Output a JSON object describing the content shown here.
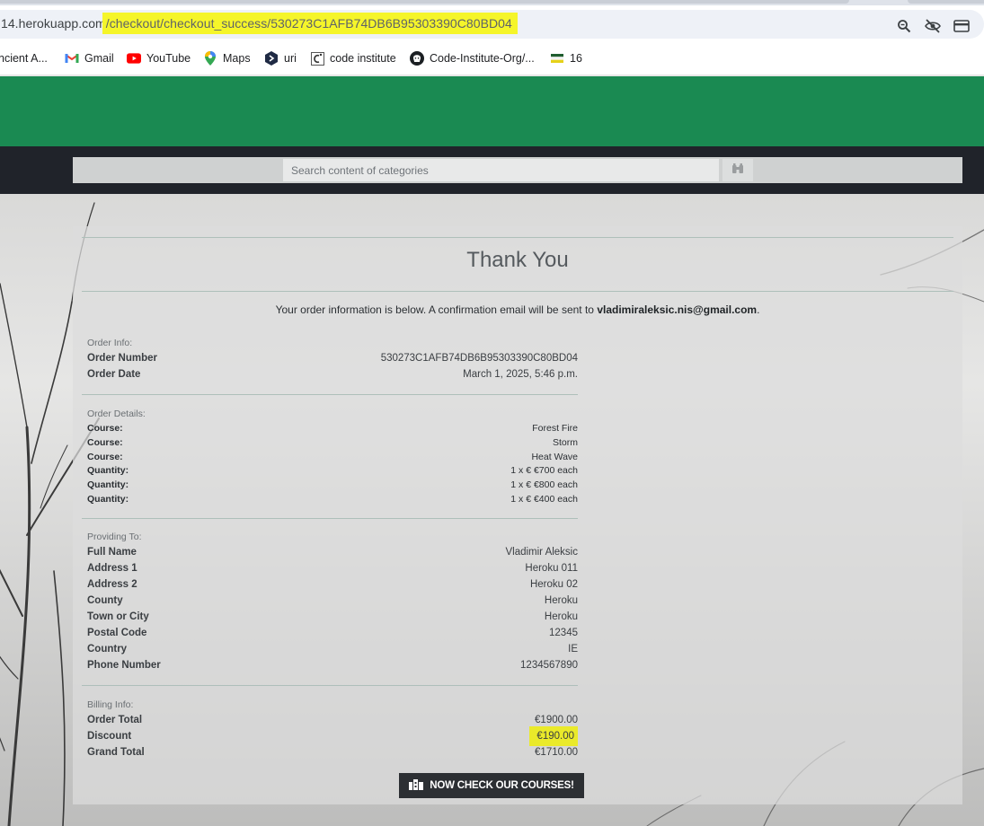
{
  "browser": {
    "url_prefix": "14.herokuapp.com",
    "url_path": "/checkout/checkout_success/530273C1AFB74DB6B95303390C80BD04",
    "address_icons": [
      "zoom-icon",
      "eye-slash-icon",
      "card-icon"
    ],
    "bookmarks": [
      {
        "label": "ncient A...",
        "icon": "page-icon"
      },
      {
        "label": "Gmail",
        "icon": "gmail-icon"
      },
      {
        "label": "YouTube",
        "icon": "youtube-icon"
      },
      {
        "label": "Maps",
        "icon": "maps-icon"
      },
      {
        "label": "uri",
        "icon": "uri-icon"
      },
      {
        "label": "code institute",
        "icon": "code-institute-icon"
      },
      {
        "label": "Code-Institute-Org/...",
        "icon": "github-icon"
      },
      {
        "label": "16",
        "icon": "flag-icon"
      }
    ]
  },
  "site": {
    "search_placeholder": "Search content of categories",
    "colors": {
      "header_green": "#1a8a52",
      "nav_dark": "#20232a"
    }
  },
  "page": {
    "title": "Thank You",
    "intro_text": "Your order information is below. A confirmation email will be sent to",
    "email": "vladimiraleksic.nis@gmail.com",
    "intro_end": ".",
    "order_info": {
      "label": "Order Info:",
      "rows": [
        {
          "label": "Order Number",
          "value": "530273C1AFB74DB6B95303390C80BD04"
        },
        {
          "label": "Order Date",
          "value": "March 1, 2025, 5:46 p.m."
        }
      ]
    },
    "order_details": {
      "label": "Order Details:",
      "rows": [
        {
          "label": "Course:",
          "value": "Forest Fire"
        },
        {
          "label": "Course:",
          "value": "Storm"
        },
        {
          "label": "Course:",
          "value": "Heat Wave"
        },
        {
          "label": "Quantity:",
          "value": "1 x € €700 each"
        },
        {
          "label": "Quantity:",
          "value": "1 x € €800 each"
        },
        {
          "label": "Quantity:",
          "value": "1 x € €400 each"
        }
      ]
    },
    "providing_to": {
      "label": "Providing To:",
      "rows": [
        {
          "label": "Full Name",
          "value": "Vladimir Aleksic"
        },
        {
          "label": "Address 1",
          "value": "Heroku 011"
        },
        {
          "label": "Address 2",
          "value": "Heroku 02"
        },
        {
          "label": "County",
          "value": "Heroku"
        },
        {
          "label": "Town or City",
          "value": "Heroku"
        },
        {
          "label": "Postal Code",
          "value": "12345"
        },
        {
          "label": "Country",
          "value": "IE"
        },
        {
          "label": "Phone Number",
          "value": "1234567890"
        }
      ]
    },
    "billing_info": {
      "label": "Billing Info:",
      "rows": [
        {
          "label": "Order Total",
          "value": "€1900.00"
        },
        {
          "label": "Discount",
          "value": "€190.00"
        },
        {
          "label": "Grand Total",
          "value": "€1710.00"
        }
      ]
    },
    "cta_label": "NOW CHECK OUR COURSES!"
  }
}
